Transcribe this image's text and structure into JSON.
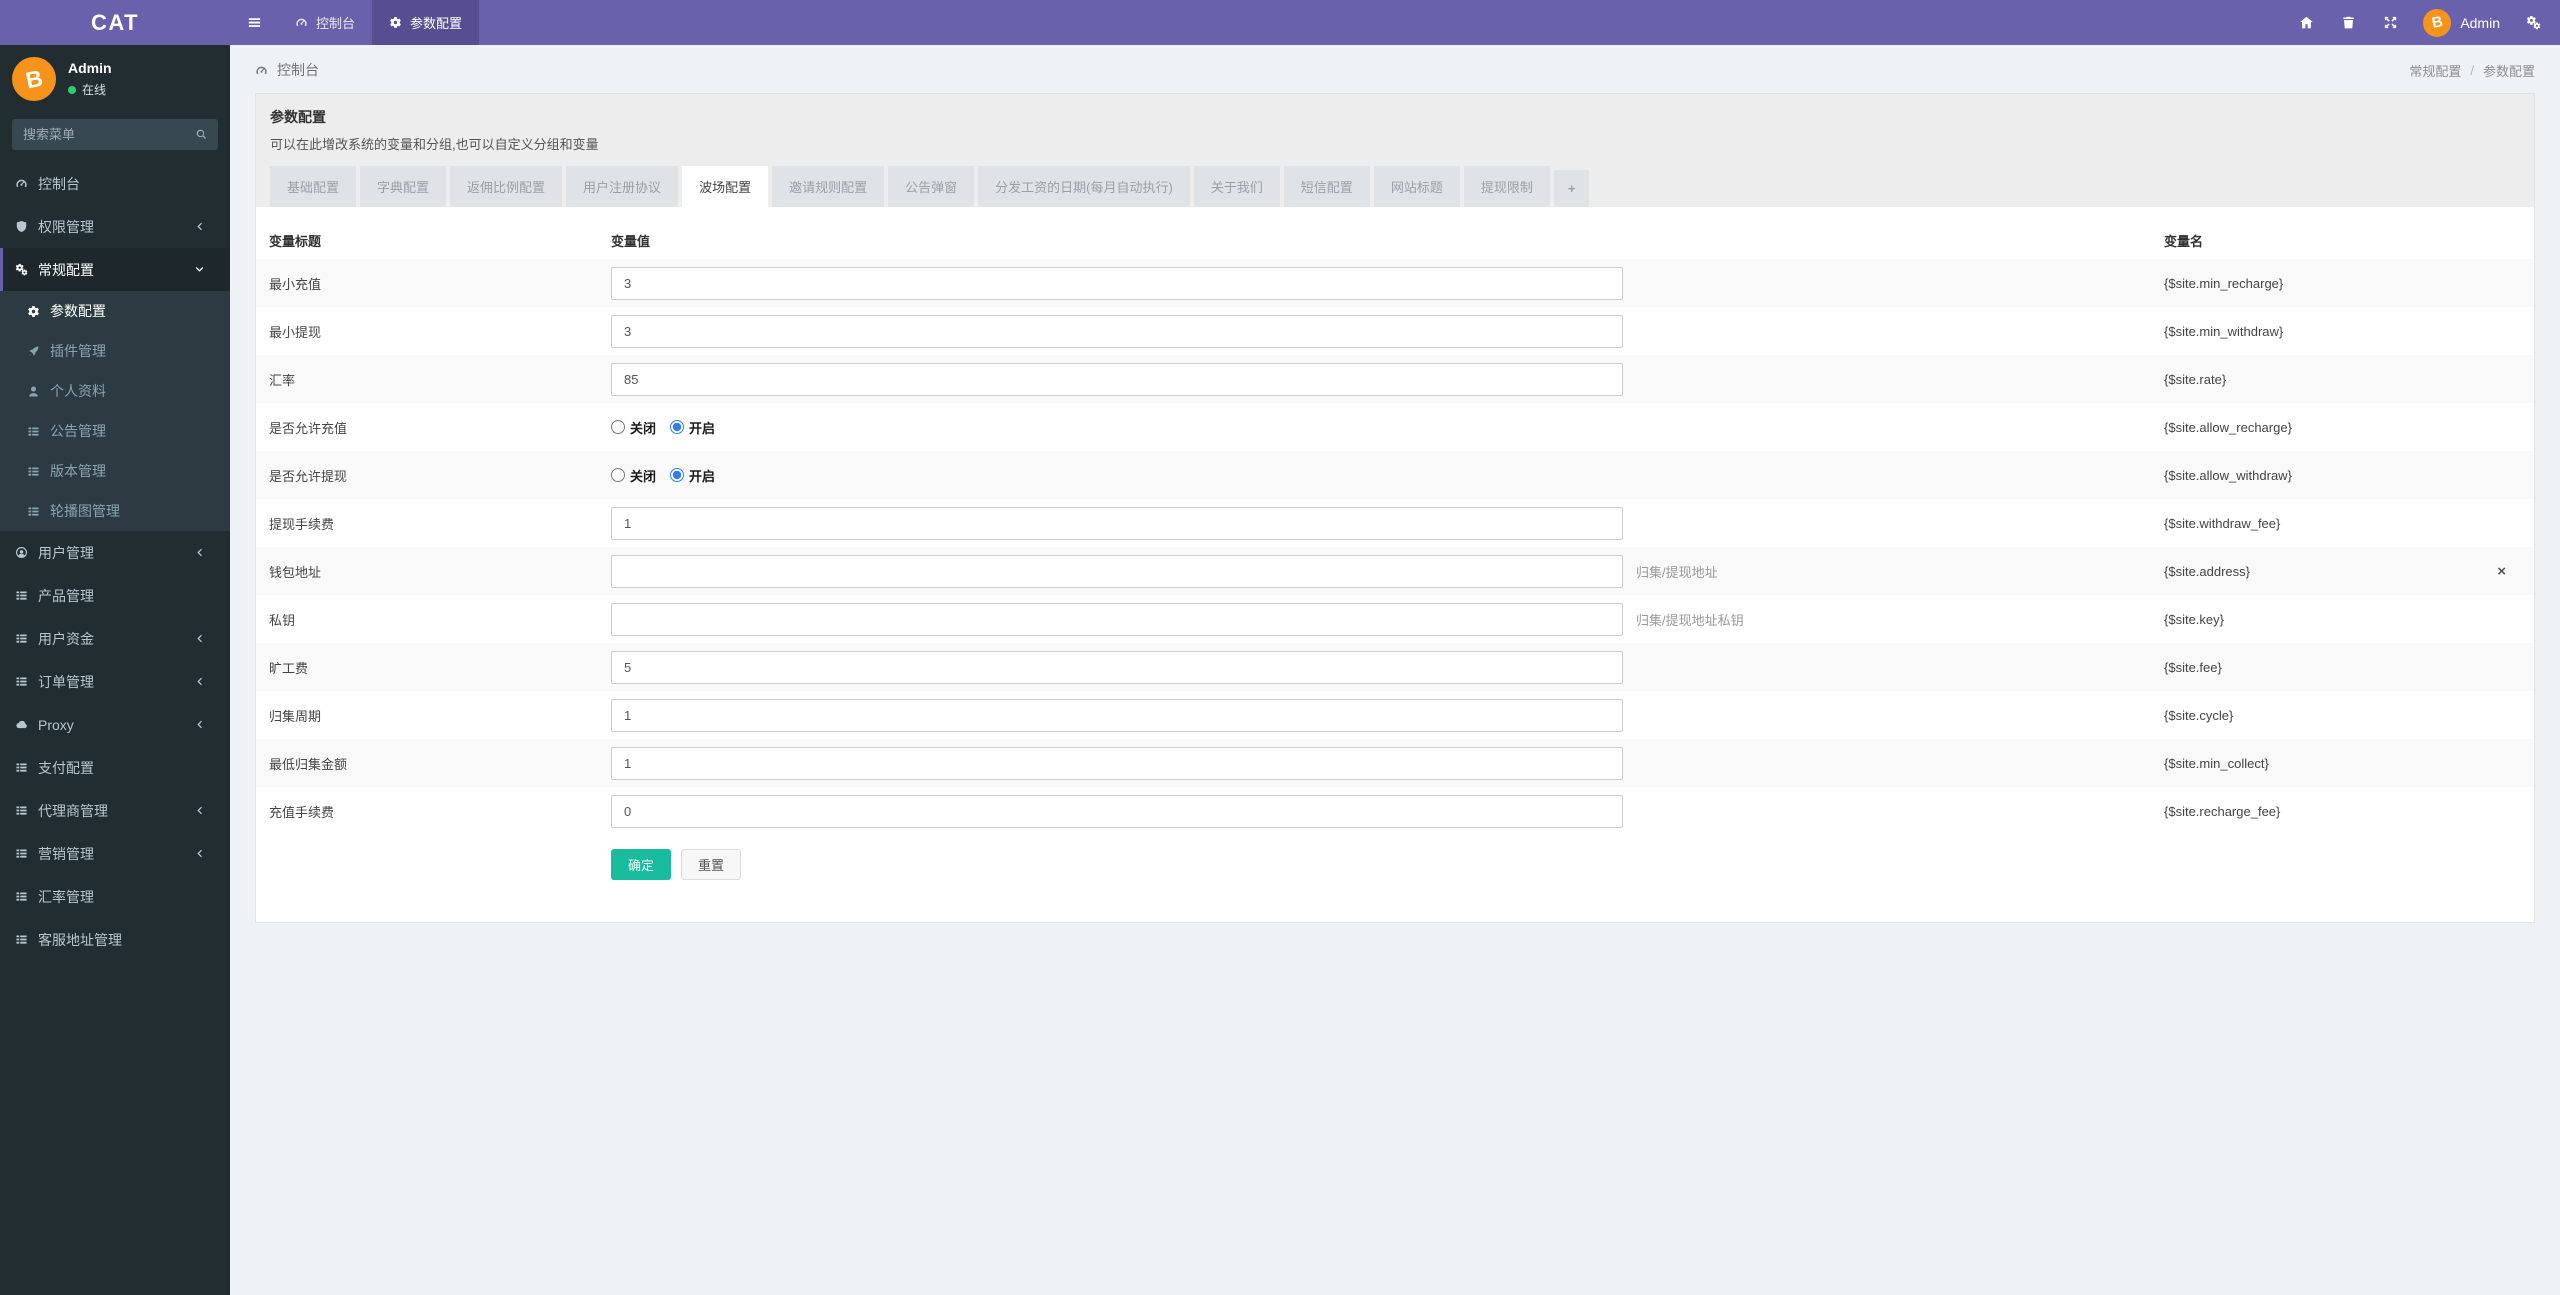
{
  "colors": {
    "navbar_purple": "#6a61ad",
    "navbar_active_purple": "#574e92",
    "sidebar_dark": "#222d32",
    "sidebar_submenu": "#2c3b41",
    "accent_green": "#18bc9c",
    "radio_blue": "#2f7cf6",
    "bitcoin_orange": "#f7931a",
    "online_green": "#2ecc71"
  },
  "navbar": {
    "brand": "CAT",
    "tabs": [
      {
        "label": "控制台",
        "icon": "gauge-icon"
      },
      {
        "label": "参数配置",
        "icon": "gear-icon",
        "active": true
      }
    ],
    "username": "Admin"
  },
  "sidebar": {
    "user": {
      "name": "Admin",
      "status": "在线"
    },
    "search_placeholder": "搜索菜单",
    "items": [
      {
        "label": "控制台",
        "icon": "gauge-icon"
      },
      {
        "label": "权限管理",
        "icon": "shield-icon",
        "has_children": true
      },
      {
        "label": "常规配置",
        "icon": "cogs-icon",
        "has_children": true,
        "expanded": true,
        "active": true,
        "children": [
          {
            "label": "参数配置",
            "icon": "gear-icon",
            "active": true
          },
          {
            "label": "插件管理",
            "icon": "rocket-icon"
          },
          {
            "label": "个人资料",
            "icon": "user-icon"
          },
          {
            "label": "公告管理",
            "icon": "list-icon"
          },
          {
            "label": "版本管理",
            "icon": "list-icon"
          },
          {
            "label": "轮播图管理",
            "icon": "list-icon"
          }
        ]
      },
      {
        "label": "用户管理",
        "icon": "user-circle-icon",
        "has_children": true
      },
      {
        "label": "产品管理",
        "icon": "list-icon"
      },
      {
        "label": "用户资金",
        "icon": "list-icon",
        "has_children": true
      },
      {
        "label": "订单管理",
        "icon": "list-icon",
        "has_children": true
      },
      {
        "label": "Proxy",
        "icon": "cloud-icon",
        "has_children": true
      },
      {
        "label": "支付配置",
        "icon": "list-icon"
      },
      {
        "label": "代理商管理",
        "icon": "list-icon",
        "has_children": true
      },
      {
        "label": "营销管理",
        "icon": "list-icon",
        "has_children": true
      },
      {
        "label": "汇率管理",
        "icon": "list-icon"
      },
      {
        "label": "客服地址管理",
        "icon": "list-icon"
      }
    ]
  },
  "breadcrumb": {
    "left": "控制台",
    "right": [
      "常规配置",
      "参数配置"
    ],
    "separator": "/"
  },
  "panel": {
    "title": "参数配置",
    "subtitle": "可以在此增改系统的变量和分组,也可以自定义分组和变量"
  },
  "tabs": {
    "items": [
      "基础配置",
      "字典配置",
      "返佣比例配置",
      "用户注册协议",
      "波场配置",
      "邀请规则配置",
      "公告弹窗",
      "分发工资的日期(每月自动执行)",
      "关于我们",
      "短信配置",
      "网站标题",
      "提现限制"
    ],
    "active": "波场配置",
    "add_label": "+"
  },
  "table": {
    "headers": [
      "变量标题",
      "变量值",
      "变量名"
    ],
    "rows": [
      {
        "label": "最小充值",
        "type": "text",
        "value": "3",
        "varname": "{$site.min_recharge}"
      },
      {
        "label": "最小提现",
        "type": "text",
        "value": "3",
        "varname": "{$site.min_withdraw}"
      },
      {
        "label": "汇率",
        "type": "text",
        "value": "85",
        "varname": "{$site.rate}"
      },
      {
        "label": "是否允许充值",
        "type": "radio",
        "options": [
          "关闭",
          "开启"
        ],
        "value": "开启",
        "varname": "{$site.allow_recharge}"
      },
      {
        "label": "是否允许提现",
        "type": "radio",
        "options": [
          "关闭",
          "开启"
        ],
        "value": "开启",
        "varname": "{$site.allow_withdraw}"
      },
      {
        "label": "提现手续费",
        "type": "text",
        "value": "1",
        "varname": "{$site.withdraw_fee}"
      },
      {
        "label": "钱包地址",
        "type": "text",
        "value": "",
        "hint": "归集/提现地址",
        "varname": "{$site.address}",
        "removable": true
      },
      {
        "label": "私钥",
        "type": "text",
        "value": "",
        "hint": "归集/提现地址私钥",
        "varname": "{$site.key}"
      },
      {
        "label": "旷工费",
        "type": "text",
        "value": "5",
        "varname": "{$site.fee}"
      },
      {
        "label": "归集周期",
        "type": "text",
        "value": "1",
        "varname": "{$site.cycle}"
      },
      {
        "label": "最低归集金额",
        "type": "text",
        "value": "1",
        "varname": "{$site.min_collect}"
      },
      {
        "label": "充值手续费",
        "type": "text",
        "value": "0",
        "varname": "{$site.recharge_fee}"
      }
    ]
  },
  "actions": {
    "submit": "确定",
    "reset": "重置"
  },
  "close_icon": "×"
}
